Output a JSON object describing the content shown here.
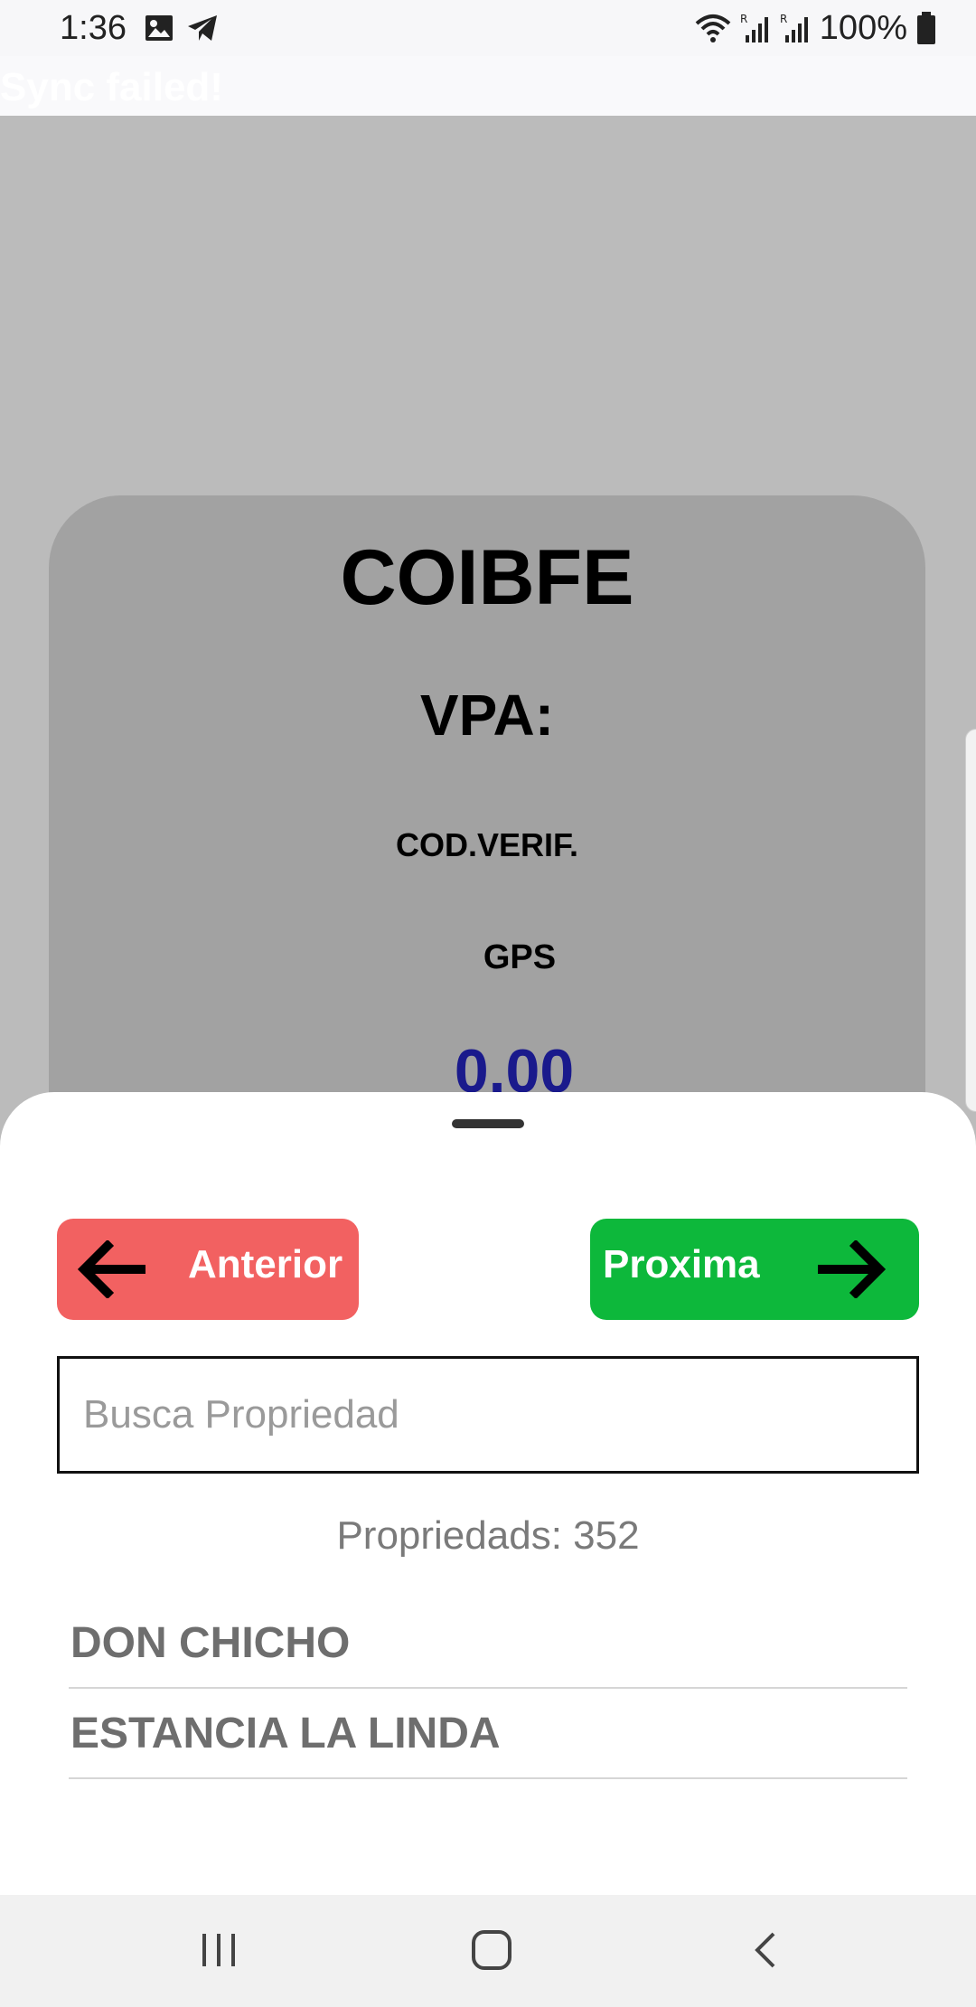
{
  "status_bar": {
    "time": "1:36",
    "battery": "100%",
    "icons": [
      "image-icon",
      "telegram-icon",
      "wifi-icon",
      "signal-r-icon",
      "signal-r-icon",
      "battery-icon"
    ]
  },
  "banner": {
    "text": "Sync failed!"
  },
  "card": {
    "title": "COIBFE",
    "vpa_label": "VPA:",
    "cod_label": "COD.VERIF.",
    "gps_label": "GPS",
    "value": "0.00",
    "value_color": "#1a1a8c"
  },
  "sheet": {
    "prev_label": "Anterior",
    "next_label": "Proxima",
    "prev_color": "#f26161",
    "next_color": "#0db83b",
    "search_placeholder": "Busca Propriedad",
    "search_value": "",
    "count_text": "Propriedads: 352",
    "items": [
      "DON CHICHO",
      "ESTANCIA LA LINDA"
    ]
  },
  "nav": {
    "icons": [
      "recent-apps-icon",
      "home-icon",
      "back-icon"
    ]
  }
}
